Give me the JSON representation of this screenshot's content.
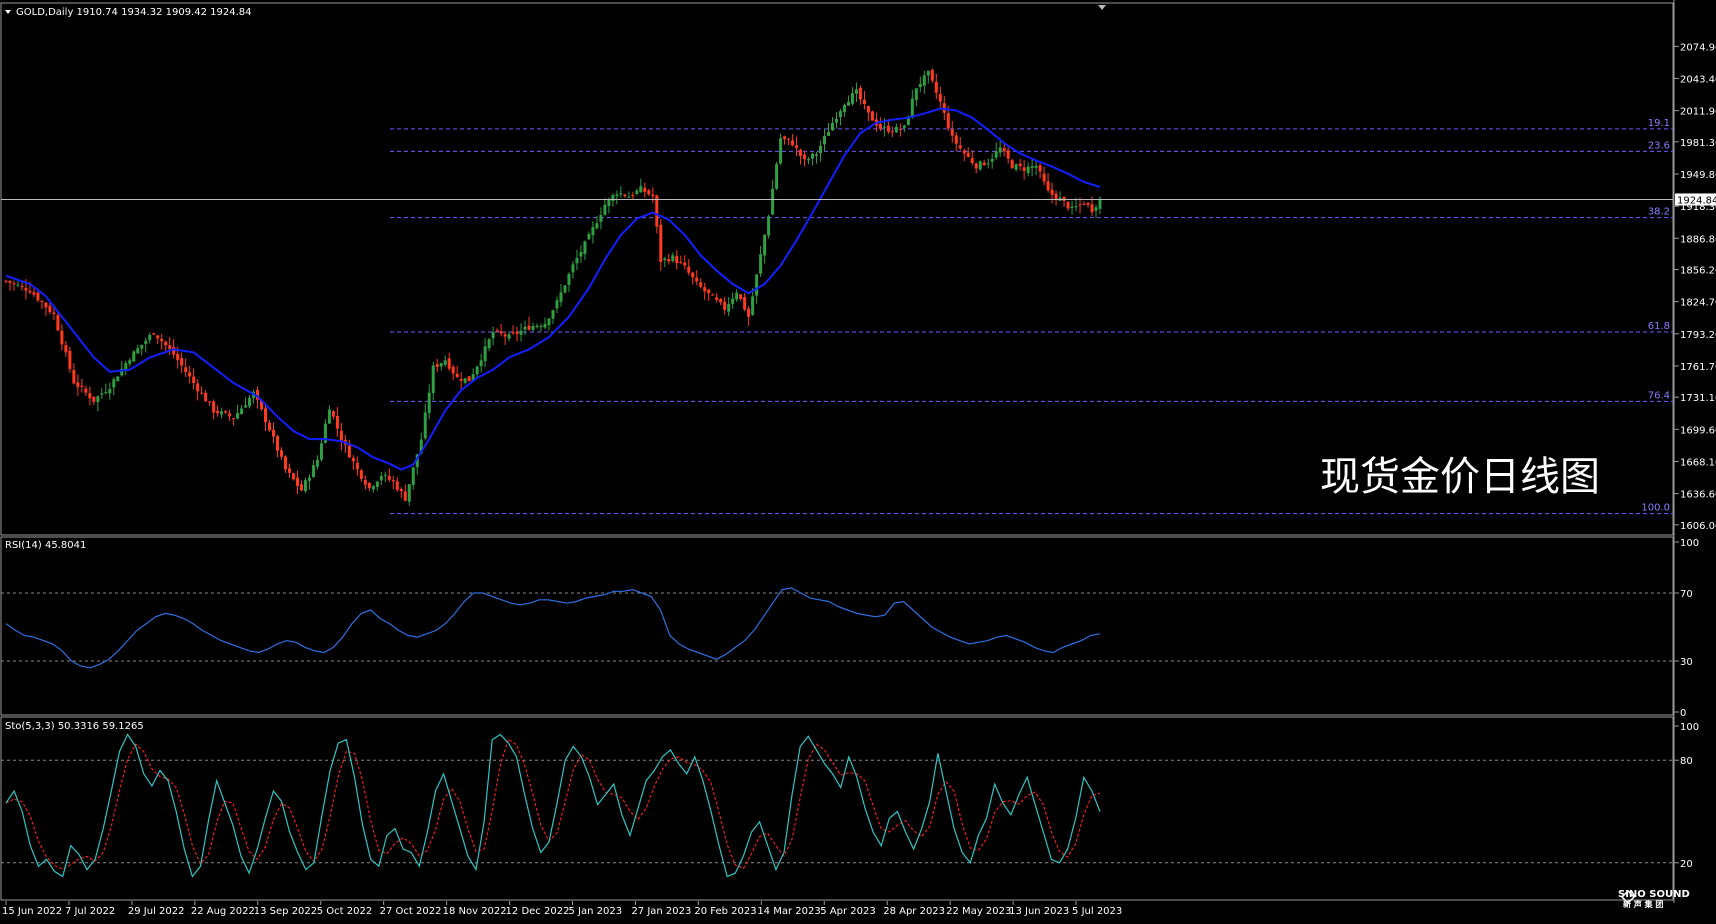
{
  "header": {
    "title": "GOLD,Daily  1910.74 1934.32 1909.42 1924.84"
  },
  "overlay_title": "现货金价日线图",
  "logo": {
    "name": "SINO SOUND",
    "subtitle": "新 声 集 团"
  },
  "colors": {
    "background": "#000000",
    "bull": "#2ea043",
    "bear": "#ff3b1f",
    "ma": "#1020ff",
    "rsi": "#2f6fe0",
    "stoch_main": "#2ec5c5",
    "stoch_signal": "#ff2020",
    "fib": "#6b5bff",
    "grid": "#888888",
    "panel_border": "#9a9a9a"
  },
  "chart_data": [
    {
      "type": "candlestick",
      "symbol": "GOLD",
      "timeframe": "Daily",
      "ohlc_last": {
        "open": 1910.74,
        "high": 1934.32,
        "low": 1909.42,
        "close": 1924.84
      },
      "current_price_label": "1924.84",
      "y_ticks": [
        "2074.90",
        "2043.40",
        "2011.90",
        "1981.30",
        "1949.80",
        "1918.30",
        "1886.80",
        "1856.20",
        "1824.70",
        "1793.20",
        "1761.70",
        "1731.10",
        "1699.60",
        "1668.10",
        "1636.60",
        "1606.00"
      ],
      "ylim": [
        1599,
        2086
      ],
      "x_tick_labels": [
        "15 Jun 2022",
        "7 Jul 2022",
        "29 Jul 2022",
        "22 Aug 2022",
        "13 Sep 2022",
        "5 Oct 2022",
        "27 Oct 2022",
        "18 Nov 2022",
        "12 Dec 2022",
        "5 Jan 2023",
        "27 Jan 2023",
        "20 Feb 2023",
        "14 Mar 2023",
        "5 Apr 2023",
        "28 Apr 2023",
        "22 May 2023",
        "13 Jun 2023",
        "5 Jul 2023"
      ],
      "fib_levels": [
        {
          "label": "19.1",
          "price": 1994
        },
        {
          "label": "23.6",
          "price": 1972
        },
        {
          "label": "38.2",
          "price": 1907
        },
        {
          "label": "61.8",
          "price": 1795
        },
        {
          "label": "76.4",
          "price": 1727
        },
        {
          "label": "100.0",
          "price": 1617
        }
      ],
      "price_path": [
        {
          "t": 0,
          "p": 1845
        },
        {
          "t": 6,
          "p": 1836
        },
        {
          "t": 12,
          "p": 1812
        },
        {
          "t": 17,
          "p": 1746
        },
        {
          "t": 22,
          "p": 1728
        },
        {
          "t": 26,
          "p": 1742
        },
        {
          "t": 31,
          "p": 1770
        },
        {
          "t": 37,
          "p": 1795
        },
        {
          "t": 42,
          "p": 1773
        },
        {
          "t": 47,
          "p": 1745
        },
        {
          "t": 52,
          "p": 1718
        },
        {
          "t": 57,
          "p": 1711
        },
        {
          "t": 62,
          "p": 1735
        },
        {
          "t": 66,
          "p": 1700
        },
        {
          "t": 70,
          "p": 1660
        },
        {
          "t": 74,
          "p": 1640
        },
        {
          "t": 78,
          "p": 1670
        },
        {
          "t": 81,
          "p": 1722
        },
        {
          "t": 84,
          "p": 1690
        },
        {
          "t": 88,
          "p": 1660
        },
        {
          "t": 91,
          "p": 1642
        },
        {
          "t": 94,
          "p": 1655
        },
        {
          "t": 97,
          "p": 1648
        },
        {
          "t": 100,
          "p": 1632
        },
        {
          "t": 104,
          "p": 1690
        },
        {
          "t": 107,
          "p": 1760
        },
        {
          "t": 110,
          "p": 1768
        },
        {
          "t": 113,
          "p": 1750
        },
        {
          "t": 116,
          "p": 1748
        },
        {
          "t": 119,
          "p": 1770
        },
        {
          "t": 122,
          "p": 1795
        },
        {
          "t": 126,
          "p": 1790
        },
        {
          "t": 131,
          "p": 1800
        },
        {
          "t": 135,
          "p": 1804
        },
        {
          "t": 138,
          "p": 1824
        },
        {
          "t": 142,
          "p": 1860
        },
        {
          "t": 146,
          "p": 1888
        },
        {
          "t": 150,
          "p": 1920
        },
        {
          "t": 153,
          "p": 1932
        },
        {
          "t": 156,
          "p": 1928
        },
        {
          "t": 159,
          "p": 1935
        },
        {
          "t": 162,
          "p": 1928
        },
        {
          "t": 164,
          "p": 1865
        },
        {
          "t": 167,
          "p": 1868
        },
        {
          "t": 170,
          "p": 1858
        },
        {
          "t": 173,
          "p": 1842
        },
        {
          "t": 177,
          "p": 1828
        },
        {
          "t": 180,
          "p": 1818
        },
        {
          "t": 183,
          "p": 1835
        },
        {
          "t": 186,
          "p": 1810
        },
        {
          "t": 189,
          "p": 1870
        },
        {
          "t": 191,
          "p": 1910
        },
        {
          "t": 194,
          "p": 1985
        },
        {
          "t": 197,
          "p": 1980
        },
        {
          "t": 200,
          "p": 1962
        },
        {
          "t": 203,
          "p": 1970
        },
        {
          "t": 207,
          "p": 2000
        },
        {
          "t": 210,
          "p": 2020
        },
        {
          "t": 213,
          "p": 2030
        },
        {
          "t": 216,
          "p": 2008
        },
        {
          "t": 219,
          "p": 1995
        },
        {
          "t": 222,
          "p": 1993
        },
        {
          "t": 225,
          "p": 1995
        },
        {
          "t": 228,
          "p": 2035
        },
        {
          "t": 231,
          "p": 2048
        },
        {
          "t": 234,
          "p": 2020
        },
        {
          "t": 237,
          "p": 1985
        },
        {
          "t": 240,
          "p": 1970
        },
        {
          "t": 243,
          "p": 1958
        },
        {
          "t": 246,
          "p": 1962
        },
        {
          "t": 249,
          "p": 1975
        },
        {
          "t": 252,
          "p": 1958
        },
        {
          "t": 255,
          "p": 1955
        },
        {
          "t": 258,
          "p": 1958
        },
        {
          "t": 261,
          "p": 1932
        },
        {
          "t": 264,
          "p": 1925
        },
        {
          "t": 267,
          "p": 1915
        },
        {
          "t": 270,
          "p": 1922
        },
        {
          "t": 272,
          "p": 1915
        },
        {
          "t": 274,
          "p": 1925
        }
      ],
      "ma_path": [
        {
          "t": 0,
          "p": 1850
        },
        {
          "t": 6,
          "p": 1842
        },
        {
          "t": 10,
          "p": 1830
        },
        {
          "t": 14,
          "p": 1810
        },
        {
          "t": 18,
          "p": 1790
        },
        {
          "t": 22,
          "p": 1770
        },
        {
          "t": 26,
          "p": 1756
        },
        {
          "t": 31,
          "p": 1758
        },
        {
          "t": 36,
          "p": 1770
        },
        {
          "t": 42,
          "p": 1778
        },
        {
          "t": 47,
          "p": 1775
        },
        {
          "t": 52,
          "p": 1760
        },
        {
          "t": 57,
          "p": 1745
        },
        {
          "t": 63,
          "p": 1732
        },
        {
          "t": 68,
          "p": 1712
        },
        {
          "t": 72,
          "p": 1698
        },
        {
          "t": 76,
          "p": 1690
        },
        {
          "t": 80,
          "p": 1690
        },
        {
          "t": 84,
          "p": 1688
        },
        {
          "t": 88,
          "p": 1682
        },
        {
          "t": 92,
          "p": 1672
        },
        {
          "t": 96,
          "p": 1666
        },
        {
          "t": 99,
          "p": 1660
        },
        {
          "t": 102,
          "p": 1665
        },
        {
          "t": 106,
          "p": 1690
        },
        {
          "t": 110,
          "p": 1718
        },
        {
          "t": 114,
          "p": 1738
        },
        {
          "t": 118,
          "p": 1750
        },
        {
          "t": 122,
          "p": 1758
        },
        {
          "t": 126,
          "p": 1770
        },
        {
          "t": 131,
          "p": 1778
        },
        {
          "t": 136,
          "p": 1790
        },
        {
          "t": 141,
          "p": 1810
        },
        {
          "t": 146,
          "p": 1838
        },
        {
          "t": 150,
          "p": 1866
        },
        {
          "t": 154,
          "p": 1890
        },
        {
          "t": 158,
          "p": 1906
        },
        {
          "t": 162,
          "p": 1912
        },
        {
          "t": 166,
          "p": 1905
        },
        {
          "t": 170,
          "p": 1890
        },
        {
          "t": 174,
          "p": 1870
        },
        {
          "t": 178,
          "p": 1855
        },
        {
          "t": 182,
          "p": 1842
        },
        {
          "t": 186,
          "p": 1833
        },
        {
          "t": 190,
          "p": 1842
        },
        {
          "t": 194,
          "p": 1860
        },
        {
          "t": 198,
          "p": 1885
        },
        {
          "t": 202,
          "p": 1912
        },
        {
          "t": 206,
          "p": 1940
        },
        {
          "t": 210,
          "p": 1968
        },
        {
          "t": 214,
          "p": 1990
        },
        {
          "t": 218,
          "p": 2000
        },
        {
          "t": 222,
          "p": 2003
        },
        {
          "t": 226,
          "p": 2005
        },
        {
          "t": 230,
          "p": 2009
        },
        {
          "t": 234,
          "p": 2014
        },
        {
          "t": 238,
          "p": 2012
        },
        {
          "t": 242,
          "p": 2005
        },
        {
          "t": 246,
          "p": 1993
        },
        {
          "t": 250,
          "p": 1980
        },
        {
          "t": 254,
          "p": 1970
        },
        {
          "t": 258,
          "p": 1963
        },
        {
          "t": 262,
          "p": 1957
        },
        {
          "t": 266,
          "p": 1950
        },
        {
          "t": 270,
          "p": 1942
        },
        {
          "t": 274,
          "p": 1937
        }
      ]
    },
    {
      "type": "line",
      "name": "RSI(14)",
      "header": "RSI(14) 45.8041",
      "last_value": 45.8041,
      "ylim": [
        0,
        100
      ],
      "y_ticks": [
        "100",
        "70",
        "30",
        "0"
      ],
      "levels": [
        70,
        30
      ],
      "values": [
        52,
        48,
        45,
        44,
        42,
        40,
        36,
        30,
        27,
        26,
        28,
        31,
        36,
        42,
        48,
        52,
        56,
        58,
        57,
        55,
        52,
        48,
        45,
        42,
        40,
        38,
        36,
        35,
        37,
        40,
        42,
        41,
        38,
        36,
        35,
        38,
        44,
        52,
        58,
        60,
        55,
        52,
        48,
        45,
        44,
        46,
        48,
        52,
        58,
        65,
        70,
        70,
        68,
        66,
        64,
        63,
        64,
        66,
        66,
        65,
        64,
        65,
        67,
        68,
        69,
        71,
        71,
        72,
        70,
        68,
        60,
        45,
        40,
        37,
        35,
        33,
        31,
        34,
        38,
        42,
        48,
        56,
        64,
        72,
        73,
        70,
        67,
        66,
        65,
        62,
        60,
        58,
        57,
        56,
        57,
        64,
        65,
        60,
        55,
        50,
        47,
        44,
        42,
        40,
        41,
        42,
        44,
        45,
        43,
        41,
        38,
        36,
        35,
        38,
        40,
        42,
        45,
        46
      ],
      "t_end": 274
    },
    {
      "type": "line",
      "name": "Sto(5,3,3)",
      "header": "Sto(5,3,3) 50.3316 59.1265",
      "main_last": 50.3316,
      "signal_last": 59.1265,
      "ylim": [
        0,
        100
      ],
      "y_ticks": [
        "100",
        "80",
        "20"
      ],
      "levels": [
        80,
        20
      ],
      "main": [
        55,
        62,
        50,
        30,
        18,
        22,
        15,
        12,
        30,
        25,
        16,
        22,
        40,
        62,
        85,
        95,
        88,
        72,
        65,
        74,
        68,
        50,
        28,
        12,
        18,
        45,
        68,
        55,
        42,
        24,
        14,
        28,
        46,
        62,
        56,
        38,
        26,
        16,
        20,
        48,
        74,
        90,
        92,
        70,
        42,
        22,
        18,
        36,
        40,
        28,
        26,
        18,
        38,
        62,
        72,
        56,
        40,
        24,
        16,
        44,
        92,
        95,
        90,
        82,
        60,
        40,
        26,
        32,
        55,
        80,
        88,
        82,
        70,
        54,
        60,
        66,
        48,
        36,
        52,
        68,
        74,
        82,
        86,
        78,
        72,
        82,
        68,
        50,
        30,
        12,
        14,
        24,
        38,
        44,
        30,
        16,
        26,
        60,
        88,
        94,
        86,
        78,
        72,
        64,
        82,
        70,
        52,
        38,
        30,
        46,
        50,
        38,
        28,
        40,
        56,
        84,
        62,
        40,
        26,
        20,
        36,
        46,
        66,
        55,
        48,
        60,
        70,
        54,
        38,
        22,
        20,
        28,
        46,
        70,
        62,
        50
      ],
      "signal_offset": 1,
      "t_end": 274
    }
  ]
}
